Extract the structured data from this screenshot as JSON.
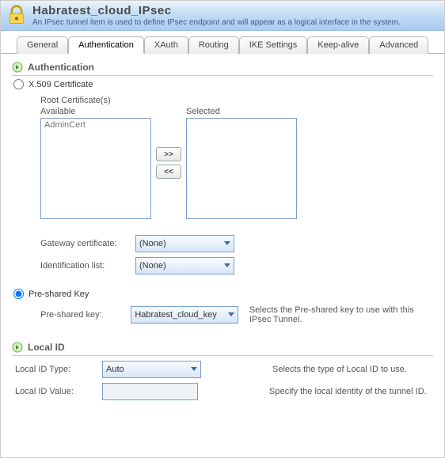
{
  "header": {
    "title": "Habratest_cloud_IPsec",
    "subtitle": "An IPsec tunnel item is used to define IPsec endpoint and will appear as a logical interface in the system."
  },
  "tabs": [
    "General",
    "Authentication",
    "XAuth",
    "Routing",
    "IKE Settings",
    "Keep-alive",
    "Advanced"
  ],
  "active_tab": 1,
  "auth": {
    "section_title": "Authentication",
    "x509_label": "X.509 Certificate",
    "root_cert_label": "Root Certificate(s)",
    "available_label": "Available",
    "selected_label": "Selected",
    "available_items": [
      "AdminCert"
    ],
    "btn_add": ">>",
    "btn_remove": "<<",
    "gateway_cert_label": "Gateway certificate:",
    "gateway_cert_value": "(None)",
    "ident_list_label": "Identification list:",
    "ident_list_value": "(None)",
    "psk_radio_label": "Pre-shared Key",
    "psk_field_label": "Pre-shared key:",
    "psk_value": "Habratest_cloud_key",
    "psk_helper": "Selects the Pre-shared key to use with this IPsec Tunnel."
  },
  "localid": {
    "section_title": "Local ID",
    "type_label": "Local ID Type:",
    "type_value": "Auto",
    "type_helper": "Selects the type of Local ID to use.",
    "value_label": "Local ID Value:",
    "value_value": "",
    "value_helper": "Specify the local identity of the tunnel ID."
  }
}
